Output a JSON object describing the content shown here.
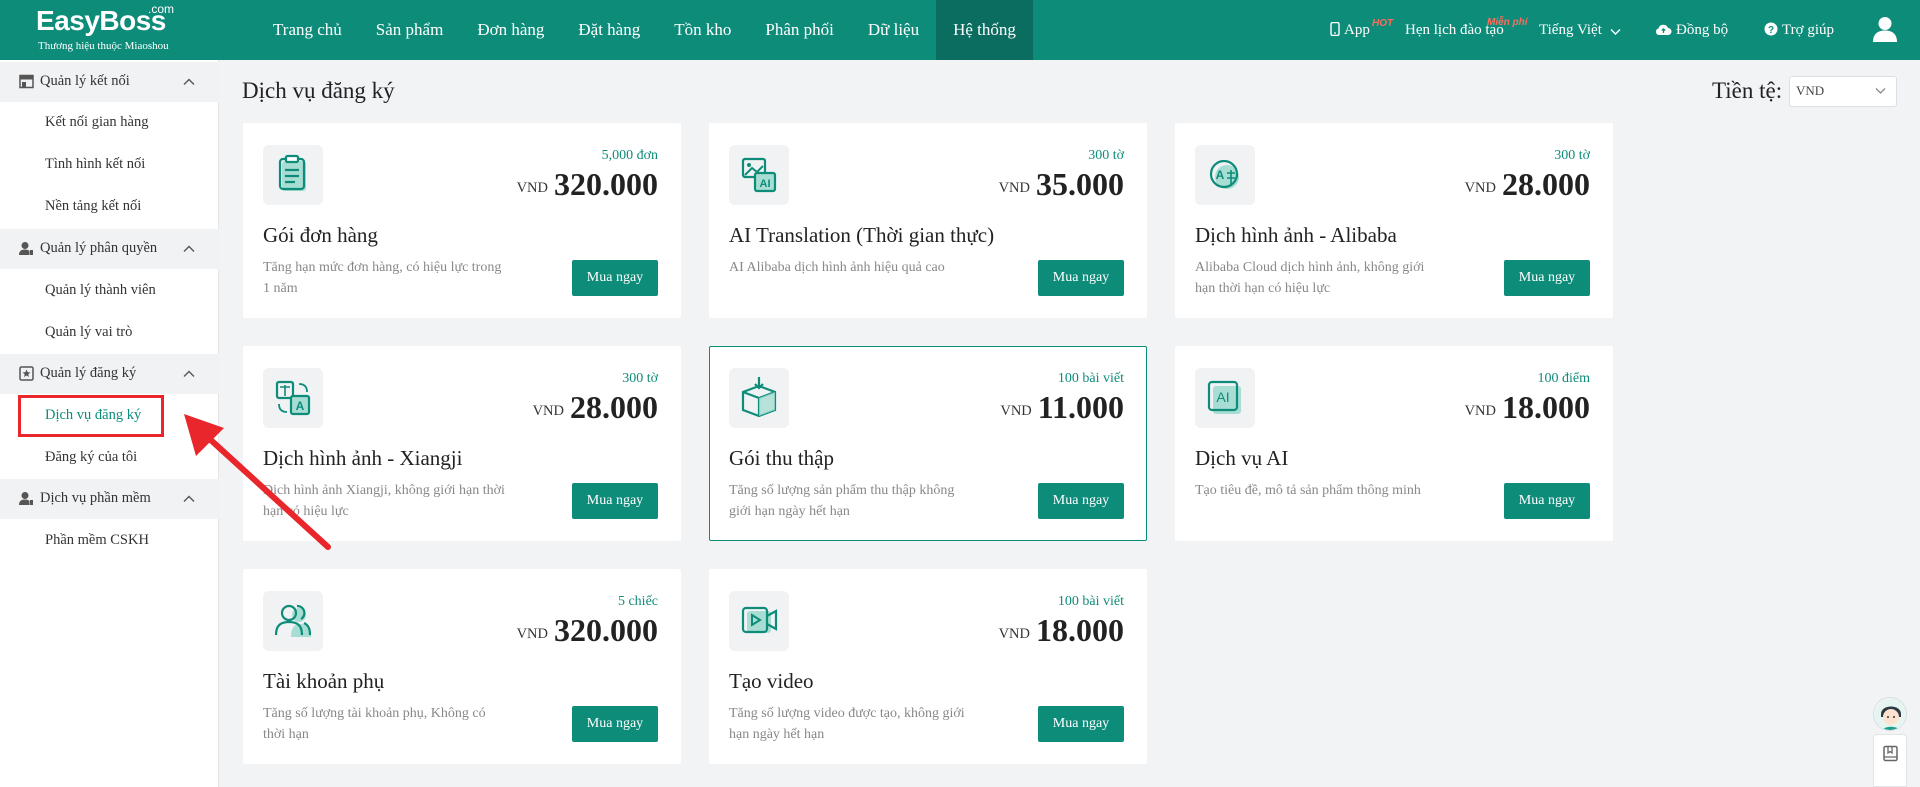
{
  "header": {
    "logo_main": "EasyBoss",
    "logo_com": ".com",
    "logo_sub": "Thương hiệu thuộc Miaoshou",
    "nav": [
      {
        "label": "Trang chủ"
      },
      {
        "label": "Sản phẩm"
      },
      {
        "label": "Đơn hàng"
      },
      {
        "label": "Đặt hàng"
      },
      {
        "label": "Tồn kho"
      },
      {
        "label": "Phân phối"
      },
      {
        "label": "Dữ liệu"
      },
      {
        "label": "Hệ thống",
        "active": true
      }
    ],
    "app_label": "App",
    "app_badge": "HOT",
    "training_label": "Hẹn lịch đào tạo",
    "training_badge": "Miễn phí",
    "language": "Tiếng Việt",
    "sync_label": "Đồng bộ",
    "help_label": "Trợ giúp"
  },
  "sidebar": {
    "groups": [
      {
        "label": "Quản lý kết nối",
        "icon": "store-icon",
        "items": [
          "Kết nối gian hàng",
          "Tình hình kết nối",
          "Nền tảng kết nối"
        ]
      },
      {
        "label": "Quản lý phân quyền",
        "icon": "user-key-icon",
        "items": [
          "Quản lý thành viên",
          "Quản lý vai trò"
        ]
      },
      {
        "label": "Quản lý đăng ký",
        "icon": "star-box-icon",
        "items": [
          "Dịch vụ đăng ký",
          "Đăng ký của tôi"
        ]
      },
      {
        "label": "Dịch vụ phần mềm",
        "icon": "user-service-icon",
        "items": [
          "Phần mềm CSKH"
        ]
      }
    ],
    "active_item": "Dịch vụ đăng ký"
  },
  "main": {
    "title": "Dịch vụ đăng ký",
    "currency_label": "Tiền tệ:",
    "currency_value": "VND",
    "buy_label": "Mua ngay",
    "cards": [
      {
        "icon": "clipboard-icon",
        "unit": "5,000 đơn",
        "currency": "VND",
        "price": "320.000",
        "name": "Gói đơn hàng",
        "desc": "Tăng hạn mức đơn hàng, có hiệu lực trong 1 năm"
      },
      {
        "icon": "ai-image-icon",
        "unit": "300 tờ",
        "currency": "VND",
        "price": "35.000",
        "name": "AI Translation (Thời gian thực)",
        "desc": "AI Alibaba dịch hình ảnh hiệu quả cao"
      },
      {
        "icon": "translate-circle-icon",
        "unit": "300 tờ",
        "currency": "VND",
        "price": "28.000",
        "name": "Dịch hình ảnh - Alibaba",
        "desc": "Alibaba Cloud dịch hình ảnh, không giới hạn thời hạn có hiệu lực"
      },
      {
        "icon": "translate-box-icon",
        "unit": "300 tờ",
        "currency": "VND",
        "price": "28.000",
        "name": "Dịch hình ảnh - Xiangji",
        "desc": "Dịch hình ảnh Xiangji, không giới hạn thời hạn có hiệu lực"
      },
      {
        "icon": "collect-box-icon",
        "unit": "100 bài viết",
        "currency": "VND",
        "price": "11.000",
        "name": "Gói thu thập",
        "desc": "Tăng số lượng sản phẩm thu thập không giới hạn ngày hết hạn",
        "selected": true
      },
      {
        "icon": "ai-box-icon",
        "unit": "100 điểm",
        "currency": "VND",
        "price": "18.000",
        "name": "Dịch vụ AI",
        "desc": "Tạo tiêu đề, mô tả sản phẩm thông minh"
      },
      {
        "icon": "users-icon",
        "unit": "5 chiếc",
        "currency": "VND",
        "price": "320.000",
        "name": "Tài khoản phụ",
        "desc": "Tăng số lượng tài khoản phụ,  Không có thời hạn"
      },
      {
        "icon": "video-icon",
        "unit": "100 bài viết",
        "currency": "VND",
        "price": "18.000",
        "name": "Tạo video",
        "desc": "Tăng số lượng video được tạo, không giới hạn ngày hết hạn"
      }
    ]
  },
  "colors": {
    "brand": "#0e8c7a",
    "brand_dark": "#0a6d5f",
    "highlight": "#e8262b",
    "hot": "#ff6b5b"
  }
}
